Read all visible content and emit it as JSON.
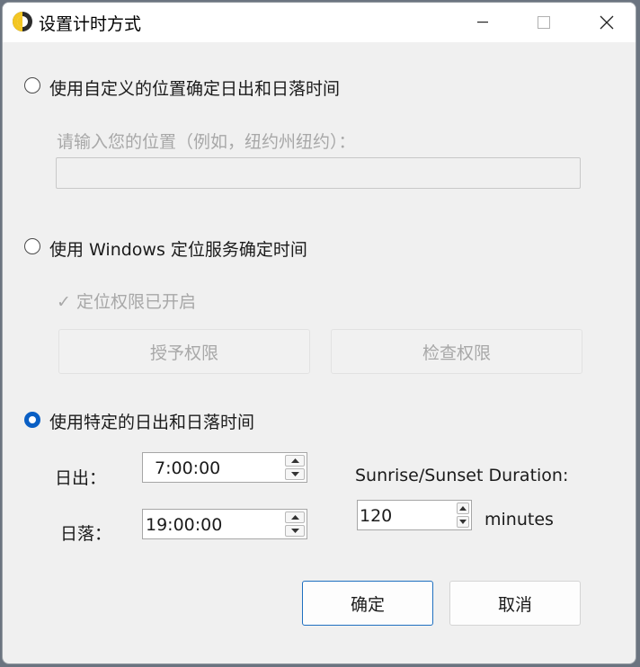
{
  "window": {
    "title": "设置计时方式"
  },
  "options": {
    "custom_location": {
      "label": "使用自定义的位置确定日出和日落时间",
      "prompt": "请输入您的位置（例如，纽约州纽约）：",
      "value": ""
    },
    "windows_location": {
      "label": "使用 Windows 定位服务确定时间",
      "status": "✓ 定位权限已开启",
      "grant_button": "授予权限",
      "check_button": "检查权限"
    },
    "specific_times": {
      "label": "使用特定的日出和日落时间",
      "sunrise_label": "日出：",
      "sunrise_value": "7:00:00",
      "sunset_label": "日落：",
      "sunset_value": "19:00:00",
      "duration_label": "Sunrise/Sunset Duration:",
      "duration_value": "120",
      "duration_unit": "minutes"
    }
  },
  "selected_option": "specific_times",
  "buttons": {
    "ok": "确定",
    "cancel": "取消"
  },
  "colors": {
    "accent": "#0a5fc4",
    "background": "#f0f0f0",
    "disabled_text": "#a8a8a8"
  }
}
